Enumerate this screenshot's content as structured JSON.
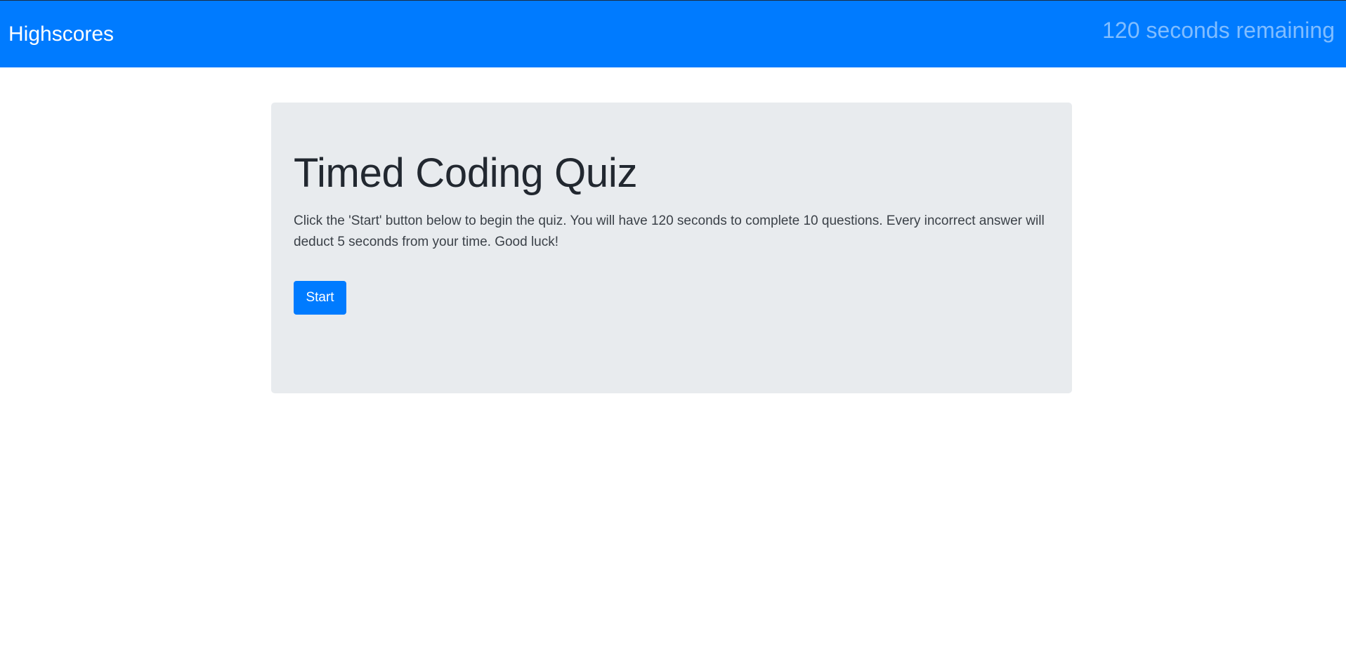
{
  "navbar": {
    "highscores_label": "Highscores",
    "timer_text": "120 seconds remaining"
  },
  "main": {
    "title": "Timed Coding Quiz",
    "intro": "Click the 'Start' button below to begin the quiz. You will have 120 seconds to complete 10 questions. Every incorrect answer will deduct 5 seconds from your time. Good luck!",
    "start_label": "Start"
  },
  "colors": {
    "primary": "#007bff",
    "jumbotron_bg": "#e8ebee",
    "text_dark": "#222830"
  }
}
